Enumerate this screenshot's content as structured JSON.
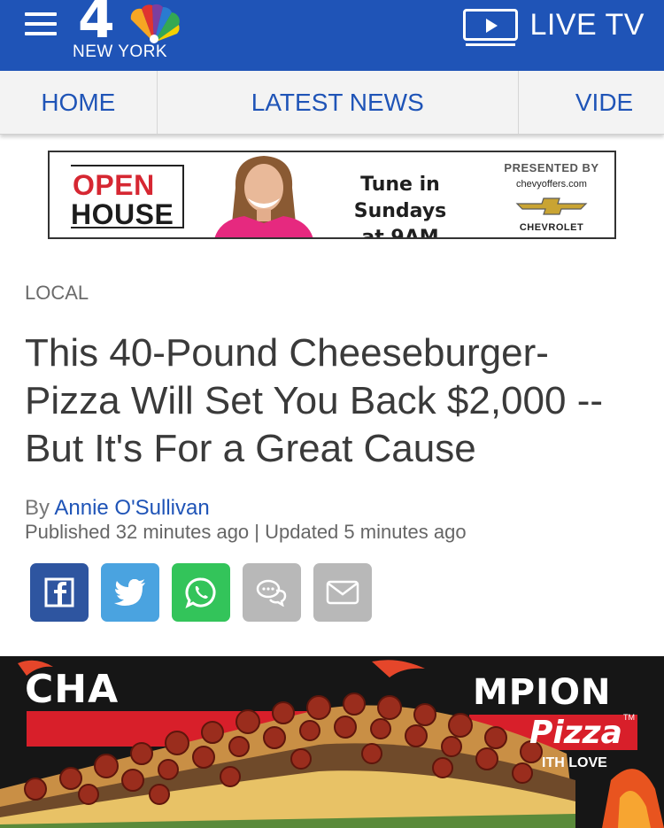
{
  "header": {
    "logo_number": "4",
    "logo_city": "NEW YORK",
    "live_tv_label": "LIVE TV",
    "brand_color": "#1f54b7"
  },
  "nav": {
    "items": [
      {
        "label": "HOME"
      },
      {
        "label": "LATEST NEWS"
      },
      {
        "label": "VIDE"
      }
    ]
  },
  "ad": {
    "show_word1": "OPEN",
    "show_word2": "HOUSE",
    "tune_line1": "Tune in Sundays",
    "tune_line2": "at 9AM",
    "presented_by": "PRESENTED BY",
    "sponsor_url": "chevyoffers.com",
    "sponsor_name": "CHEVROLET"
  },
  "article": {
    "section": "LOCAL",
    "headline": "This 40-Pound Cheeseburger-Pizza Will Set You Back $2,000 -- But It's For a Great Cause",
    "by_prefix": "By ",
    "author": "Annie O'Sullivan",
    "published": "Published 32 minutes ago | Updated 5 minutes ago"
  },
  "share": {
    "icons": [
      "facebook-icon",
      "twitter-icon",
      "whatsapp-icon",
      "comment-icon",
      "email-icon"
    ],
    "colors": {
      "facebook": "#2e55a0",
      "twitter": "#4aa3e0",
      "whatsapp": "#33c45a",
      "muted": "#b8b8b8"
    }
  },
  "hero": {
    "banner_left": "CHA",
    "banner_right": "MPION",
    "brand_word": "Pizza",
    "tagline": "ITH LOVE",
    "tm": "TM"
  }
}
